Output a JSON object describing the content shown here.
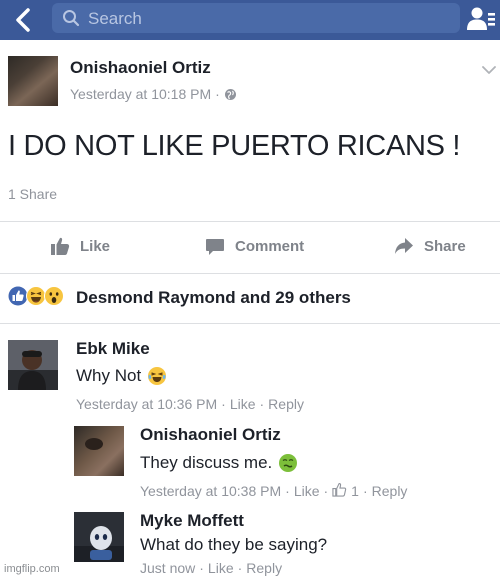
{
  "topbar": {
    "search_placeholder": "Search",
    "back_icon": "chevron-left-icon",
    "friends_icon": "friend-requests-icon"
  },
  "post": {
    "author": "Onishaoniel Ortiz",
    "timestamp": "Yesterday at 10:18 PM",
    "separator": "·",
    "privacy_icon": "globe-icon",
    "text": "I DO NOT LIKE  PUERTO RICANS !",
    "share_count": "1 Share"
  },
  "actions": {
    "like": "Like",
    "comment": "Comment",
    "share": "Share"
  },
  "reactions": {
    "icons": [
      "like-reaction-icon",
      "haha-reaction-icon",
      "wow-reaction-icon"
    ],
    "summary": "Desmond Raymond and 29 others"
  },
  "comments": [
    {
      "author": "Ebk Mike",
      "text": "Why Not",
      "emoji": "crying-laughing-emoji",
      "time": "Yesterday at 10:36 PM",
      "like": "Like",
      "reply": "Reply"
    },
    {
      "author": "Onishaoniel Ortiz",
      "text": "They discuss me.",
      "emoji": "nauseated-face-emoji",
      "time": "Yesterday at 10:38 PM",
      "like": "Like",
      "like_count": "1",
      "reply": "Reply"
    },
    {
      "author": "Myke Moffett",
      "text": "What do they be saying?",
      "time": "Just now",
      "like": "Like",
      "reply": "Reply"
    }
  ],
  "watermark": "imgflip.com",
  "colors": {
    "nav_bar": "#3b5998",
    "meta_text": "#90949c",
    "action_text": "#7f838a",
    "like_blue": "#4267b2",
    "divider": "#dddfe2"
  }
}
